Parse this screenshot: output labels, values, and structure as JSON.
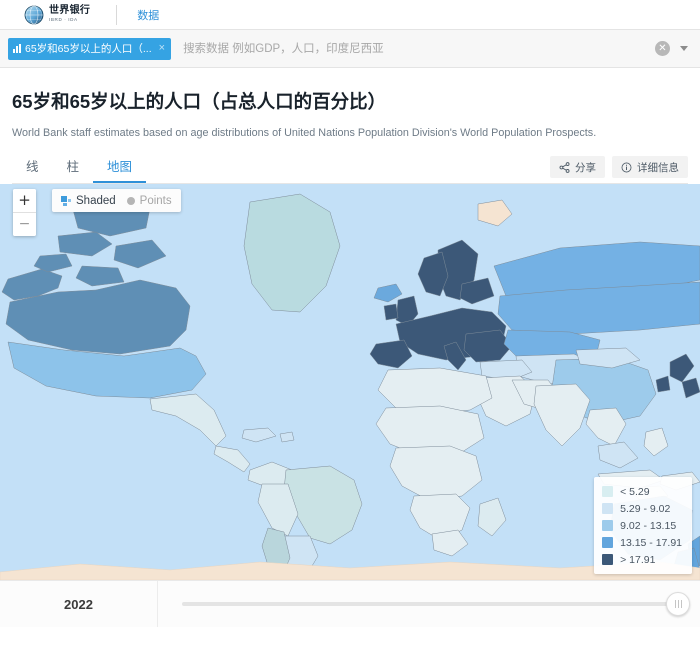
{
  "header": {
    "logo_name_cn": "世界银行",
    "logo_sub": "IBRD · IDA",
    "nav_data_label": "数据"
  },
  "search": {
    "tag_label": "65岁和65岁以上的人口（...",
    "tag_remove": "×",
    "placeholder": "搜索数据 例如GDP，人口，印度尼西亚",
    "value": "",
    "clear_label": "✕"
  },
  "page": {
    "title": "65岁和65岁以上的人口（占总人口的百分比）",
    "subtitle": "World Bank staff estimates based on age distributions of United Nations Population Division's World Population Prospects."
  },
  "tabs": [
    {
      "label": "线",
      "active": false
    },
    {
      "label": "柱",
      "active": false
    },
    {
      "label": "地图",
      "active": true
    }
  ],
  "actions": {
    "share_label": "分享",
    "details_label": "详细信息"
  },
  "map": {
    "zoom_in": "+",
    "zoom_out": "−",
    "mode_shaded": "Shaded",
    "mode_points": "Points",
    "ocean_color": "#c3e0f7",
    "nodata_color": "#f5e4d2"
  },
  "legend": {
    "items": [
      {
        "label": "< 5.29",
        "color": "#d8eef1"
      },
      {
        "label": "5.29 - 9.02",
        "color": "#cfe4f4"
      },
      {
        "label": "9.02 - 13.15",
        "color": "#9dcbeb"
      },
      {
        "label": "13.15 - 17.91",
        "color": "#६2a5dd"
      },
      {
        "label": "> 17.91",
        "color": "#3c5878"
      }
    ]
  },
  "timeline": {
    "year": "2022"
  },
  "chart_data": {
    "type": "heatmap",
    "title": "65岁和65岁以上的人口（占总人口的百分比）",
    "subtitle": "World Bank staff estimates based on age distributions of United Nations Population Division's World Population Prospects.",
    "year": "2022",
    "unit": "% of total population",
    "classes": [
      "< 5.29",
      "5.29 - 9.02",
      "9.02 - 13.15",
      "13.15 - 17.91",
      "> 17.91"
    ],
    "class_colors": [
      "#d8eef1",
      "#cfe4f4",
      "#9dcbeb",
      "#62a5dd",
      "#3c5878"
    ],
    "regions": [
      {
        "name": "Canada",
        "class": "> 17.91"
      },
      {
        "name": "United States",
        "class": "13.15 - 17.91"
      },
      {
        "name": "Greenland",
        "class": "9.02 - 13.15"
      },
      {
        "name": "Mexico",
        "class": "< 5.29"
      },
      {
        "name": "Brazil",
        "class": "5.29 - 9.02"
      },
      {
        "name": "Argentina",
        "class": "9.02 - 13.15"
      },
      {
        "name": "Western Europe",
        "class": "> 17.91"
      },
      {
        "name": "Scandinavia",
        "class": "> 17.91"
      },
      {
        "name": "Russia",
        "class": "13.15 - 17.91"
      },
      {
        "name": "China",
        "class": "9.02 - 13.15"
      },
      {
        "name": "Japan",
        "class": "> 17.91"
      },
      {
        "name": "India",
        "class": "< 5.29"
      },
      {
        "name": "Africa",
        "class": "< 5.29"
      },
      {
        "name": "Australia",
        "class": "13.15 - 17.91"
      },
      {
        "name": "New Zealand",
        "class": "13.15 - 17.91"
      },
      {
        "name": "Antarctica",
        "class": "no data"
      }
    ]
  }
}
